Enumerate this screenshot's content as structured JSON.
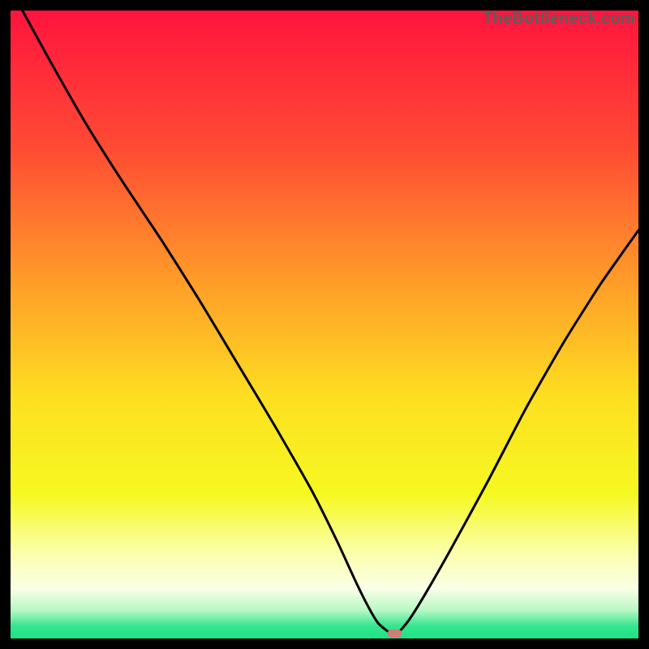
{
  "watermark": "TheBottleneck.com",
  "chart_data": {
    "type": "line",
    "title": "",
    "xlabel": "",
    "ylabel": "",
    "xlim": [
      0,
      100
    ],
    "ylim": [
      0,
      100
    ],
    "grid": false,
    "legend": false,
    "background_gradient": {
      "stops": [
        {
          "offset": 0.0,
          "color": "#ff143e"
        },
        {
          "offset": 0.22,
          "color": "#ff4b34"
        },
        {
          "offset": 0.45,
          "color": "#ffa328"
        },
        {
          "offset": 0.62,
          "color": "#fde021"
        },
        {
          "offset": 0.77,
          "color": "#f6f821"
        },
        {
          "offset": 0.86,
          "color": "#fbffa6"
        },
        {
          "offset": 0.92,
          "color": "#fbffe6"
        },
        {
          "offset": 0.955,
          "color": "#b8f8c5"
        },
        {
          "offset": 0.98,
          "color": "#35e58e"
        },
        {
          "offset": 1.0,
          "color": "#1de385"
        }
      ]
    },
    "series": [
      {
        "name": "bottleneck-curve",
        "description": "V-shaped bottleneck curve; values are percent of plot height from bottom (0=bottom, 100=top).",
        "x": [
          1.9,
          6,
          12,
          18,
          24,
          30,
          36,
          42,
          48,
          52,
          55,
          57,
          58.5,
          60,
          61.2,
          62,
          63.5,
          66,
          70,
          76,
          82,
          88,
          94,
          100
        ],
        "y": [
          100,
          92.5,
          82,
          72.5,
          63.5,
          54,
          44,
          34,
          23.5,
          15.5,
          9,
          5,
          2.5,
          1.2,
          0.8,
          1.2,
          3,
          7,
          14,
          25,
          36.5,
          47,
          56.5,
          65
        ]
      }
    ],
    "marker": {
      "name": "min-point-marker",
      "x": 61.2,
      "y": 0.8,
      "color": "#cd7d7a",
      "width_pct": 2.3,
      "height_pct": 1.3
    }
  }
}
